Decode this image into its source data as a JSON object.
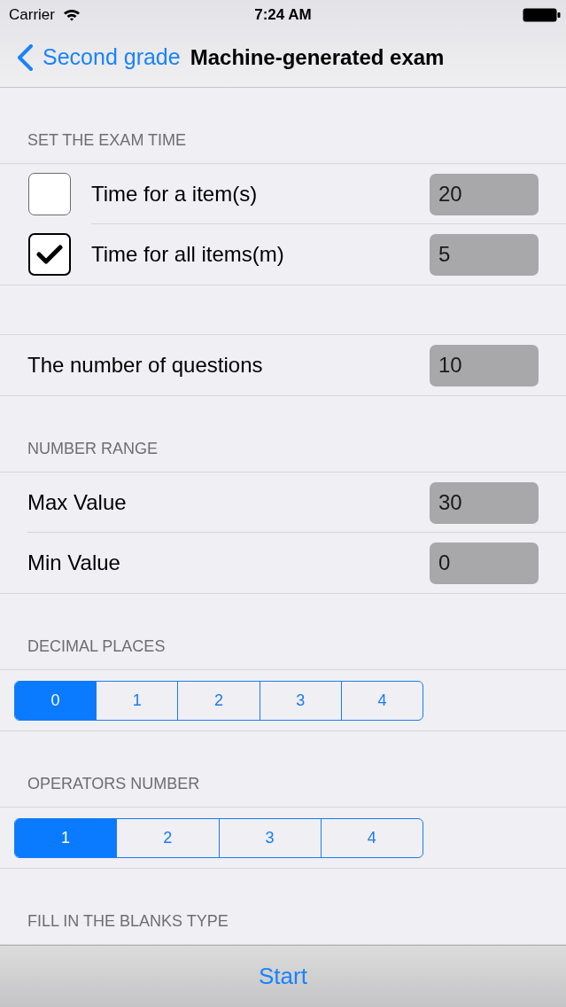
{
  "status_bar": {
    "carrier": "Carrier",
    "time": "7:24 AM"
  },
  "nav_bar": {
    "back": "Second grade",
    "title": "Machine-generated exam"
  },
  "sections": [
    {
      "header": "SET THE EXAM TIME",
      "rows": [
        {
          "kind": "checkbox_field",
          "label": "Time for a item(s)",
          "checked": false,
          "value": "20"
        },
        {
          "kind": "checkbox_field",
          "label": "Time for all items(m)",
          "checked": true,
          "value": "5"
        }
      ]
    },
    {
      "rows": [
        {
          "kind": "field",
          "label": "The number of questions",
          "value": "10"
        }
      ]
    },
    {
      "header": "NUMBER RANGE",
      "rows": [
        {
          "kind": "field",
          "label": "Max Value",
          "value": "30"
        },
        {
          "kind": "field",
          "label": "Min Value",
          "value": "0"
        }
      ]
    },
    {
      "header": "DECIMAL PLACES",
      "rows": [
        {
          "kind": "segmented",
          "segments": [
            {
              "label": "0",
              "selected": true
            },
            {
              "label": "1",
              "selected": false
            },
            {
              "label": "2",
              "selected": false
            },
            {
              "label": "3",
              "selected": false
            },
            {
              "label": "4",
              "selected": false
            }
          ]
        }
      ]
    },
    {
      "header": "OPERATORS NUMBER",
      "rows": [
        {
          "kind": "segmented",
          "segments": [
            {
              "label": "1",
              "selected": true
            },
            {
              "label": "2",
              "selected": false
            },
            {
              "label": "3",
              "selected": false
            },
            {
              "label": "4",
              "selected": false
            }
          ]
        }
      ]
    },
    {
      "header": "FILL IN THE BLANKS TYPE"
    }
  ],
  "toolbar": {
    "button": "Start"
  }
}
